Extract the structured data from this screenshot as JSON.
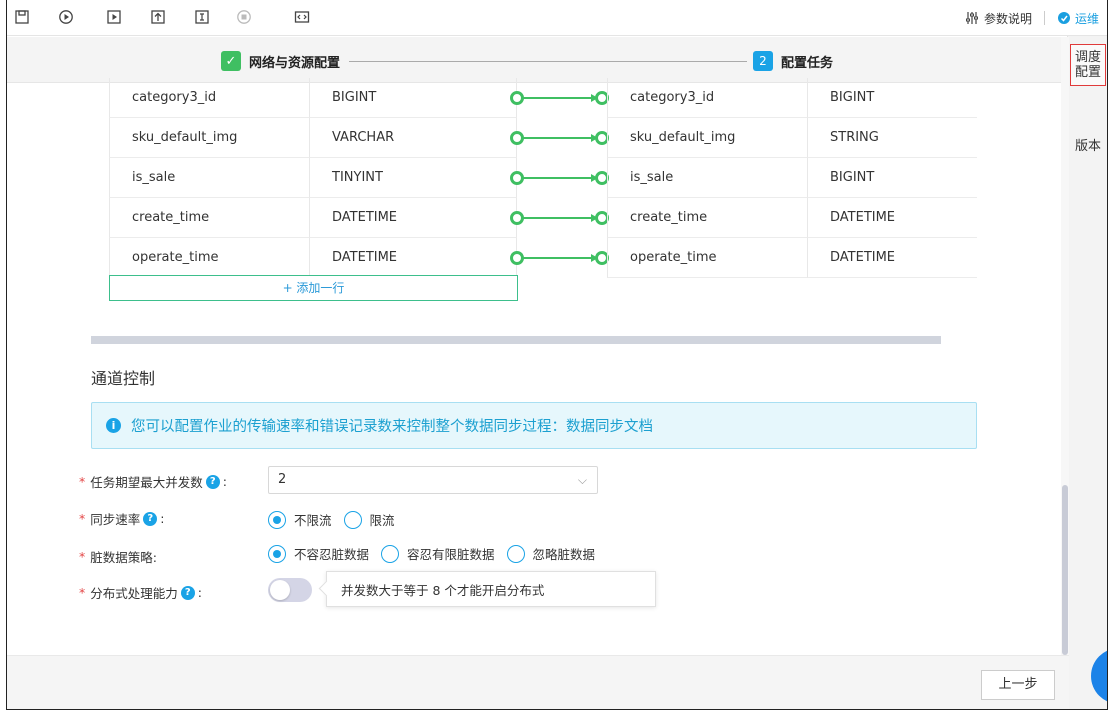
{
  "toolbar": {
    "icons": [
      "save-icon",
      "run-icon",
      "run-selected-icon",
      "submit-icon",
      "format-icon",
      "stop-icon",
      "code-icon"
    ],
    "params_label": "参数说明",
    "ops_label": "运维"
  },
  "right_panel": {
    "items": [
      {
        "label": "调度配置",
        "active": true
      },
      {
        "label": "版本",
        "active": false
      }
    ]
  },
  "steps": {
    "step1_label": "网络与资源配置",
    "step2_number": "2",
    "step2_label": "配置任务"
  },
  "mapping": {
    "rows": [
      {
        "src_name": "category3_id",
        "src_type": "BIGINT",
        "dst_name": "category3_id",
        "dst_type": "BIGINT"
      },
      {
        "src_name": "sku_default_img",
        "src_type": "VARCHAR",
        "dst_name": "sku_default_img",
        "dst_type": "STRING"
      },
      {
        "src_name": "is_sale",
        "src_type": "TINYINT",
        "dst_name": "is_sale",
        "dst_type": "BIGINT"
      },
      {
        "src_name": "create_time",
        "src_type": "DATETIME",
        "dst_name": "create_time",
        "dst_type": "DATETIME"
      },
      {
        "src_name": "operate_time",
        "src_type": "DATETIME",
        "dst_name": "operate_time",
        "dst_type": "DATETIME"
      }
    ],
    "add_row_label": "+ 添加一行",
    "connector_color": "#3fbf62"
  },
  "channel": {
    "title": "通道控制",
    "info": "您可以配置作业的传输速率和错误记录数来控制整个数据同步过程：数据同步文档",
    "concurrency_label": "任务期望最大并发数",
    "concurrency_value": "2",
    "rate_label": "同步速率",
    "rate_options": [
      {
        "label": "不限流",
        "selected": true
      },
      {
        "label": "限流",
        "selected": false
      }
    ],
    "dirty_label": "脏数据策略:",
    "dirty_options": [
      {
        "label": "不容忍脏数据",
        "selected": true
      },
      {
        "label": "容忍有限脏数据",
        "selected": false
      },
      {
        "label": "忽略脏数据",
        "selected": false
      }
    ],
    "distributed_label": "分布式处理能力",
    "distributed_tooltip": "并发数大于等于 8 个才能开启分布式",
    "colon": ":"
  },
  "footer": {
    "prev_label": "上一步"
  },
  "colors": {
    "accent": "#1aa3e6",
    "success": "#3fbf62",
    "required": "#e34646"
  }
}
